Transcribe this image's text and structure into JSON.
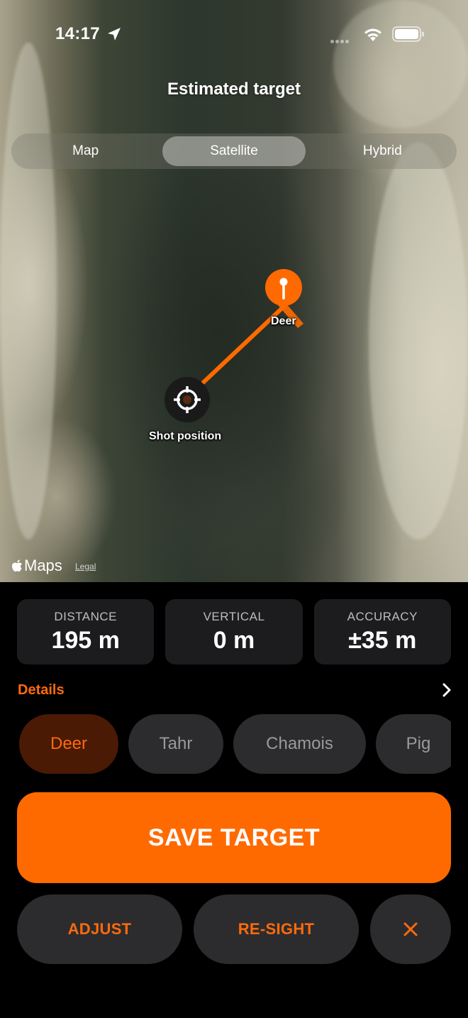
{
  "status_bar": {
    "time": "14:17",
    "icons": [
      "location-arrow-icon",
      "cellular-signal-icon",
      "wifi-icon",
      "battery-icon"
    ]
  },
  "map": {
    "title": "Estimated target",
    "map_types": [
      {
        "label": "Map",
        "selected": false
      },
      {
        "label": "Satellite",
        "selected": true
      },
      {
        "label": "Hybrid",
        "selected": false
      }
    ],
    "target_pin_label": "Deer",
    "shot_position_label": "Shot position",
    "attribution": {
      "logo_text": "Maps",
      "legal": "Legal"
    }
  },
  "stats": [
    {
      "label": "DISTANCE",
      "value": "195 m"
    },
    {
      "label": "VERTICAL",
      "value": "0 m"
    },
    {
      "label": "ACCURACY",
      "value": "±35 m"
    }
  ],
  "details": {
    "label": "Details"
  },
  "species": [
    {
      "label": "Deer",
      "selected": true
    },
    {
      "label": "Tahr",
      "selected": false
    },
    {
      "label": "Chamois",
      "selected": false
    },
    {
      "label": "Pig",
      "selected": false
    }
  ],
  "buttons": {
    "save": "SAVE TARGET",
    "adjust": "ADJUST",
    "resight": "RE-SIGHT",
    "close": "✕"
  },
  "colors": {
    "accent": "#ff6a00",
    "accent_text": "#ff6a0d",
    "selected_chip_bg": "#4a1a05",
    "card_bg": "#1c1c1e",
    "chip_bg": "#2c2c2e"
  }
}
